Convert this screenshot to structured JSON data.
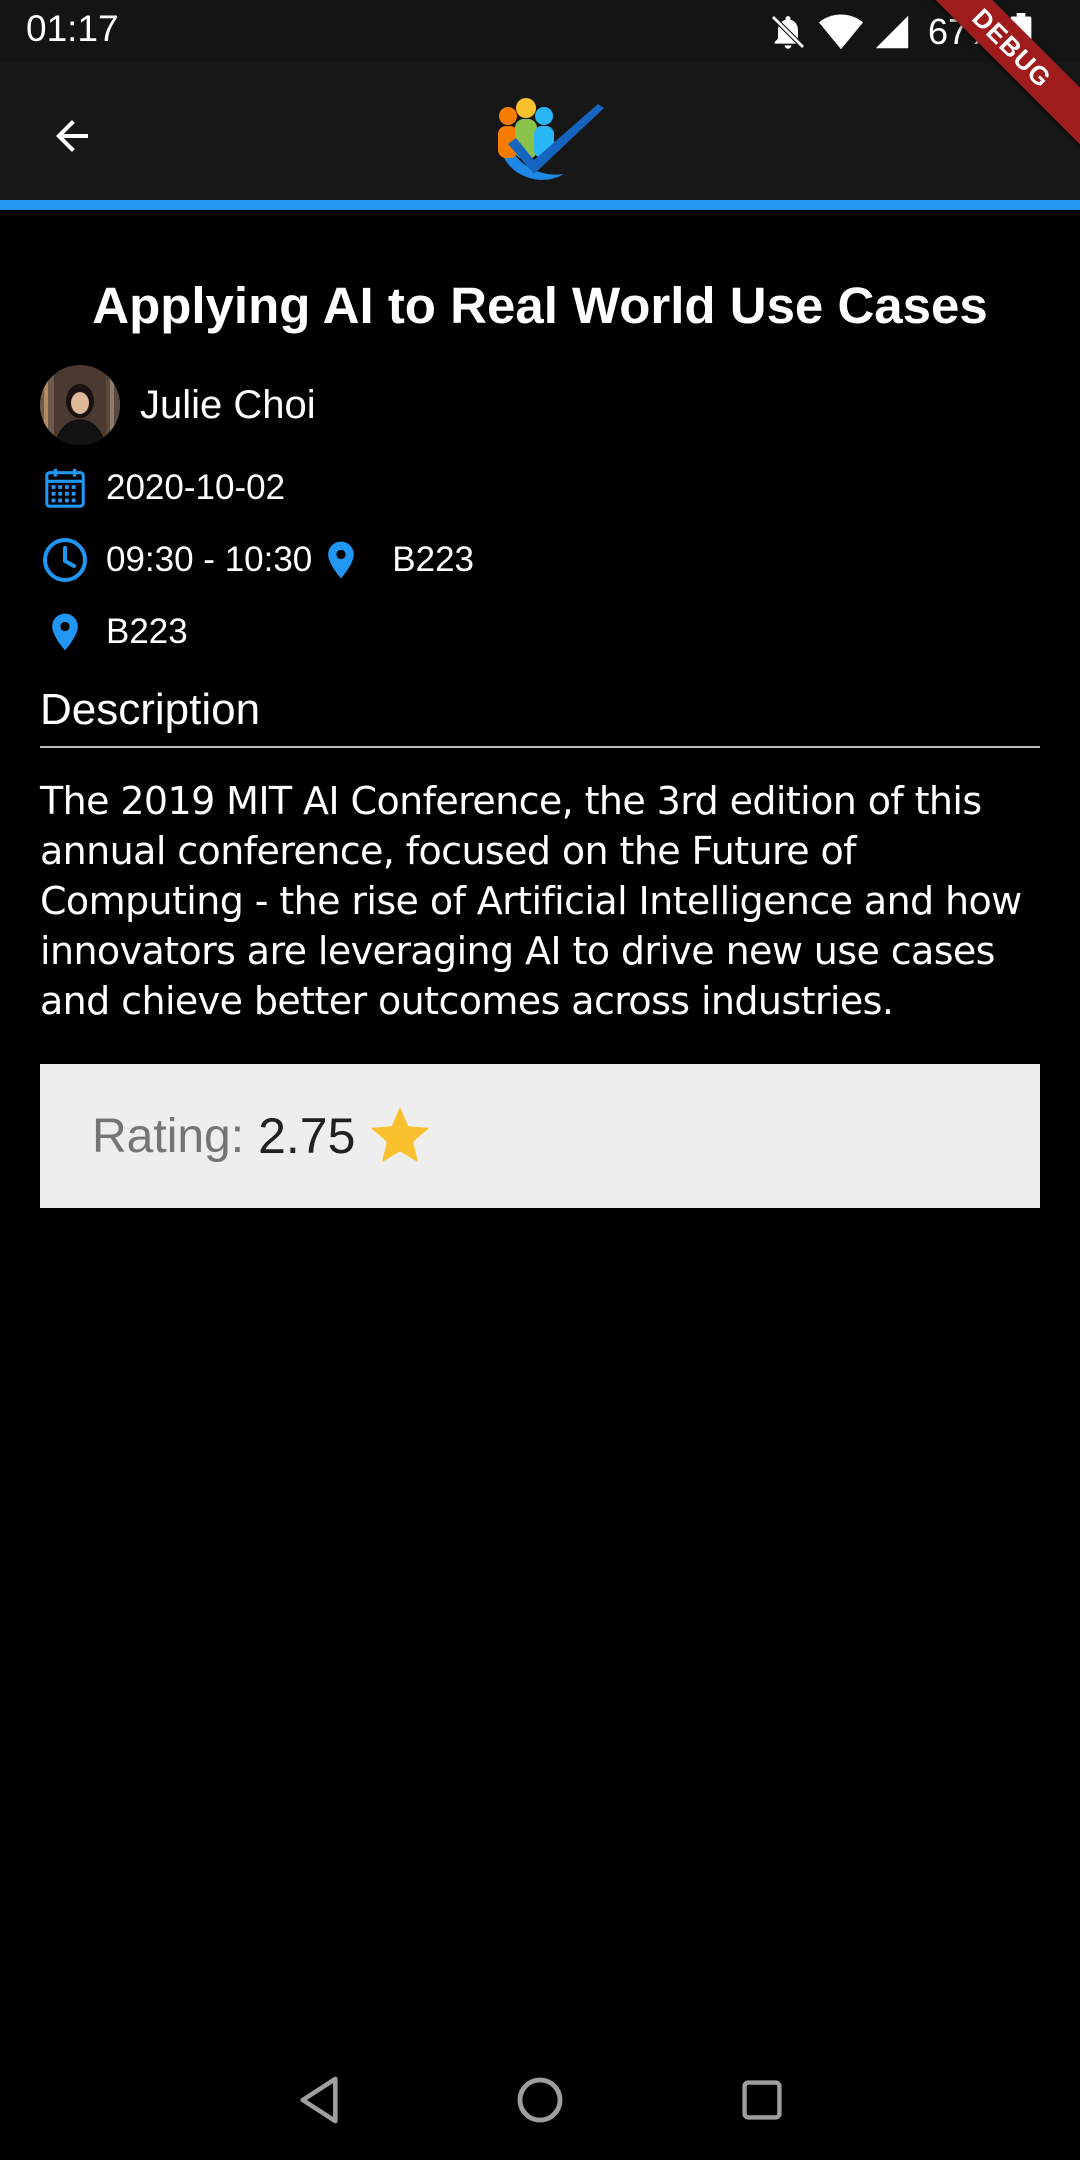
{
  "status_bar": {
    "time": "01:17",
    "battery": "67%",
    "icons": [
      "bell-off-icon",
      "wifi-icon",
      "cellular-icon",
      "battery-icon"
    ]
  },
  "debug_banner": {
    "label": "DEBUG"
  },
  "app_bar": {
    "back_icon": "arrow-back-icon",
    "logo": "conference-logo",
    "accent_color": "#2196f3"
  },
  "session": {
    "title": "Applying AI to Real World Use Cases",
    "speaker": "Julie Choi",
    "date": "2020-10-02",
    "time": "09:30 - 10:30",
    "room_inline": "B223",
    "room": "B223",
    "description_heading": "Description",
    "description": "The 2019 MIT AI Conference, the 3rd edition of this annual conference, focused on the Future of Computing - the rise of Artificial Intelligence and how innovators are leveraging AI to drive new use cases and chieve better outcomes across industries.",
    "rating_label": "Rating:",
    "rating_value": "2.75"
  },
  "colors": {
    "icon_blue": "#2196f3",
    "star_gold": "#fbc02d",
    "card_bg": "#eeeeee"
  },
  "nav_bar": {
    "icons": [
      "back-triangle-icon",
      "home-circle-icon",
      "recents-square-icon"
    ]
  }
}
